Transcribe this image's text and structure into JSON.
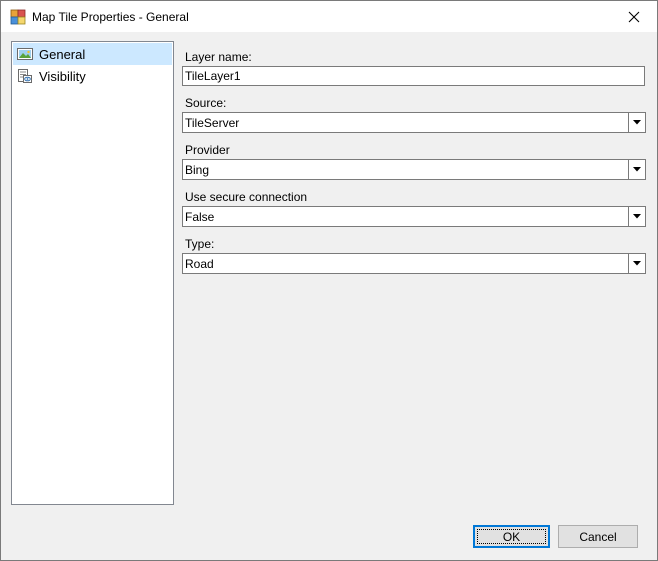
{
  "window": {
    "title": "Map Tile Properties - General"
  },
  "nav": {
    "items": [
      {
        "label": "General",
        "icon": "map-layer-icon",
        "selected": true
      },
      {
        "label": "Visibility",
        "icon": "visibility-icon",
        "selected": false
      }
    ]
  },
  "form": {
    "layer_name": {
      "label": "Layer name:",
      "value": "TileLayer1"
    },
    "source": {
      "label": "Source:",
      "value": "TileServer"
    },
    "provider": {
      "label": "Provider",
      "value": "Bing"
    },
    "secure": {
      "label": "Use secure connection",
      "value": "False"
    },
    "type": {
      "label": "Type:",
      "value": "Road"
    }
  },
  "buttons": {
    "ok": "OK",
    "cancel": "Cancel"
  },
  "colors": {
    "selection": "#cce8ff",
    "default_button_border": "#0078d7"
  }
}
